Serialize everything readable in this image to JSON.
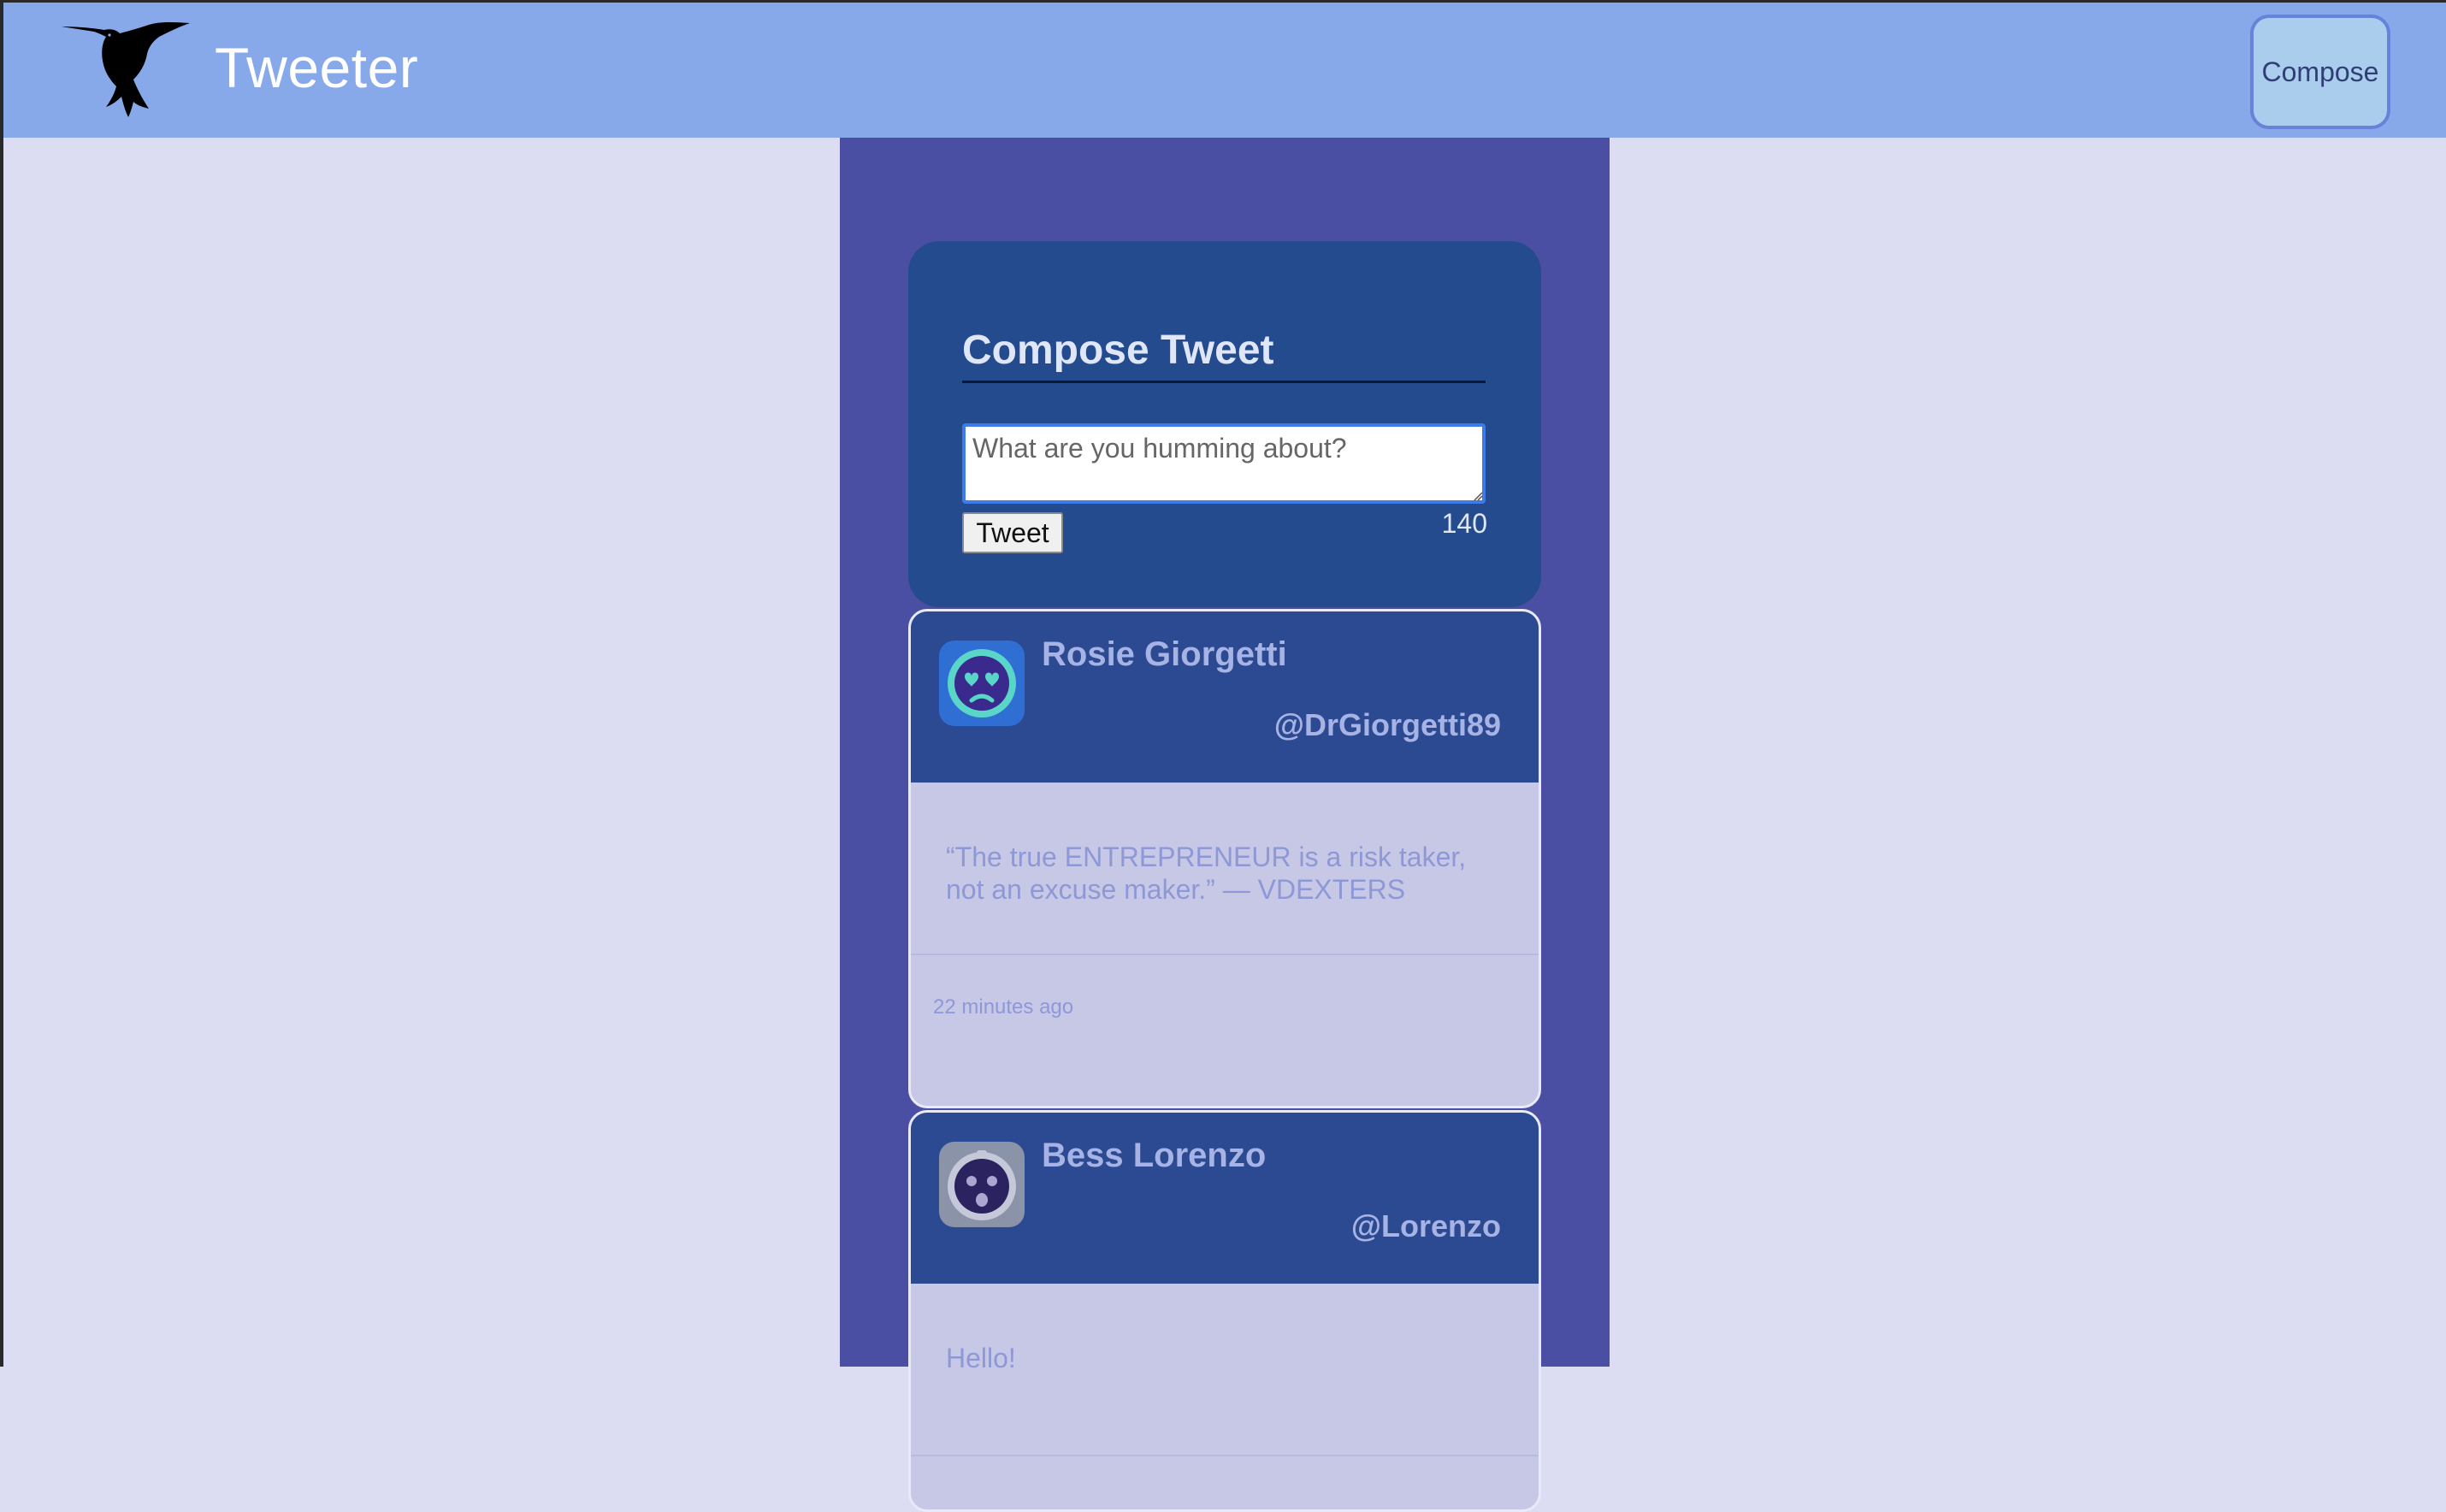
{
  "app": {
    "brand": "Tweeter",
    "compose_nav_label": "Compose"
  },
  "compose": {
    "title": "Compose Tweet",
    "placeholder": "What are you humming about?",
    "submit_label": "Tweet",
    "char_count": "140"
  },
  "tweets": [
    {
      "name": "Rosie Giorgetti",
      "handle": "@DrGiorgetti89",
      "text": "“The true ENTREPRENEUR is a risk taker, not an excuse maker.”  — VDEXTERS",
      "time": "22 minutes ago",
      "avatar_icon": "heart-eyes-face-icon"
    },
    {
      "name": "Bess Lorenzo",
      "handle": "@Lorenzo",
      "text": "Hello!",
      "avatar_icon": "surprised-face-icon"
    }
  ],
  "colors": {
    "navbar": "#87a9e9",
    "page_background": "#dcdcf2",
    "column": "#4a4fa3",
    "compose_card": "#234b8d",
    "tweet_header": "#2c4a92",
    "tweet_body": "#c6c8e6",
    "compose_button": "#aacdee"
  }
}
